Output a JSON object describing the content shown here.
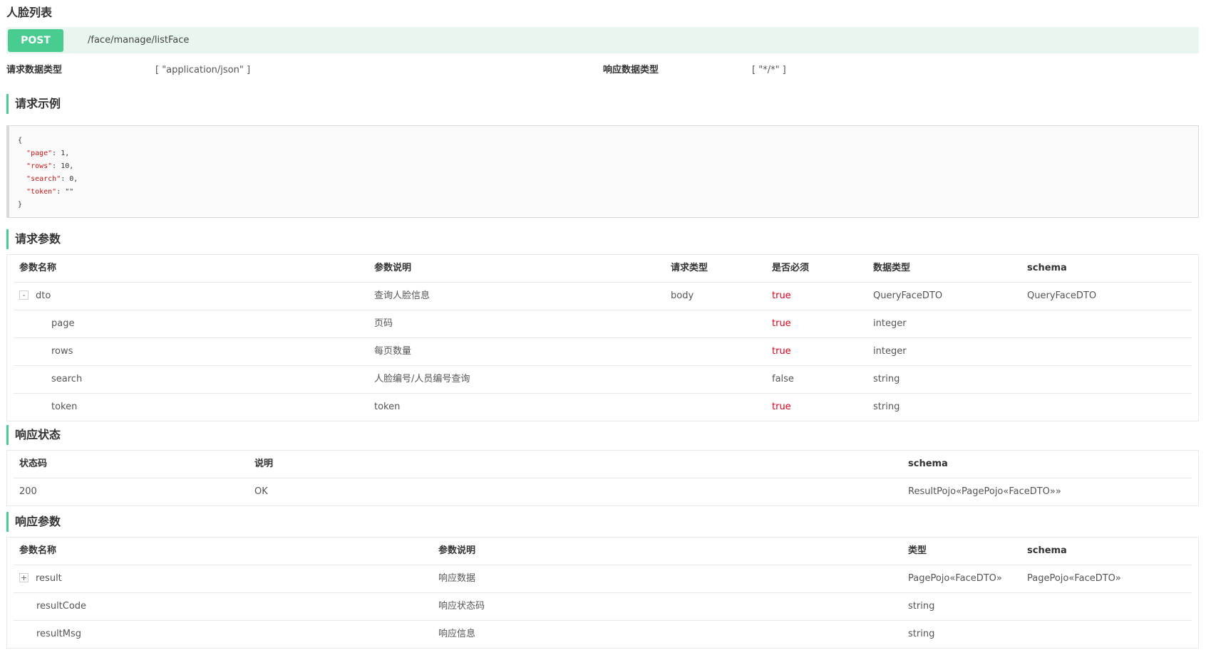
{
  "api": {
    "title": "人脸列表",
    "method": "POST",
    "path": "/face/manage/listFace",
    "request_type_label": "请求数据类型",
    "request_type_value": "[ \"application/json\" ]",
    "response_type_label": "响应数据类型",
    "response_type_value": "[ \"*/*\" ]"
  },
  "colors": {
    "accent": "#49cc90",
    "method_bar_bg": "#e8f6ef",
    "required_true": "#d9001b"
  },
  "example": {
    "title": "请求示例",
    "lines": [
      {
        "open": "{"
      },
      {
        "key": "\"page\"",
        "sep": ": ",
        "value": "1,"
      },
      {
        "key": "\"rows\"",
        "sep": ": ",
        "value": "10,"
      },
      {
        "key": "\"search\"",
        "sep": ": ",
        "value": "0,"
      },
      {
        "key": "\"token\"",
        "sep": ": ",
        "value": "\"\""
      },
      {
        "open": "}"
      }
    ]
  },
  "request_params": {
    "title": "请求参数",
    "headers": [
      "参数名称",
      "参数说明",
      "请求类型",
      "是否必须",
      "数据类型",
      "schema"
    ],
    "rows": [
      {
        "toggle": "-",
        "name": "dto",
        "desc": "查询人脸信息",
        "in": "body",
        "required": "true",
        "type": "QueryFaceDTO",
        "schema": "QueryFaceDTO"
      },
      {
        "name": "page",
        "desc": "页码",
        "in": "",
        "required": "true",
        "type": "integer",
        "schema": ""
      },
      {
        "name": "rows",
        "desc": "每页数量",
        "in": "",
        "required": "true",
        "type": "integer",
        "schema": ""
      },
      {
        "name": "search",
        "desc": "人脸编号/人员编号查询",
        "in": "",
        "required": "false",
        "type": "string",
        "schema": ""
      },
      {
        "name": "token",
        "desc": "token",
        "in": "",
        "required": "true",
        "type": "string",
        "schema": ""
      }
    ]
  },
  "response_status": {
    "title": "响应状态",
    "headers": [
      "状态码",
      "说明",
      "schema"
    ],
    "rows": [
      {
        "code": "200",
        "desc": "OK",
        "schema": "ResultPojo«PagePojo«FaceDTO»»"
      }
    ]
  },
  "response_params": {
    "title": "响应参数",
    "headers": [
      "参数名称",
      "参数说明",
      "类型",
      "schema"
    ],
    "rows": [
      {
        "toggle": "+",
        "name": "result",
        "desc": "响应数据",
        "type": "PagePojo«FaceDTO»",
        "schema": "PagePojo«FaceDTO»"
      },
      {
        "name": "resultCode",
        "desc": "响应状态码",
        "type": "string",
        "schema": ""
      },
      {
        "name": "resultMsg",
        "desc": "响应信息",
        "type": "string",
        "schema": ""
      }
    ]
  }
}
